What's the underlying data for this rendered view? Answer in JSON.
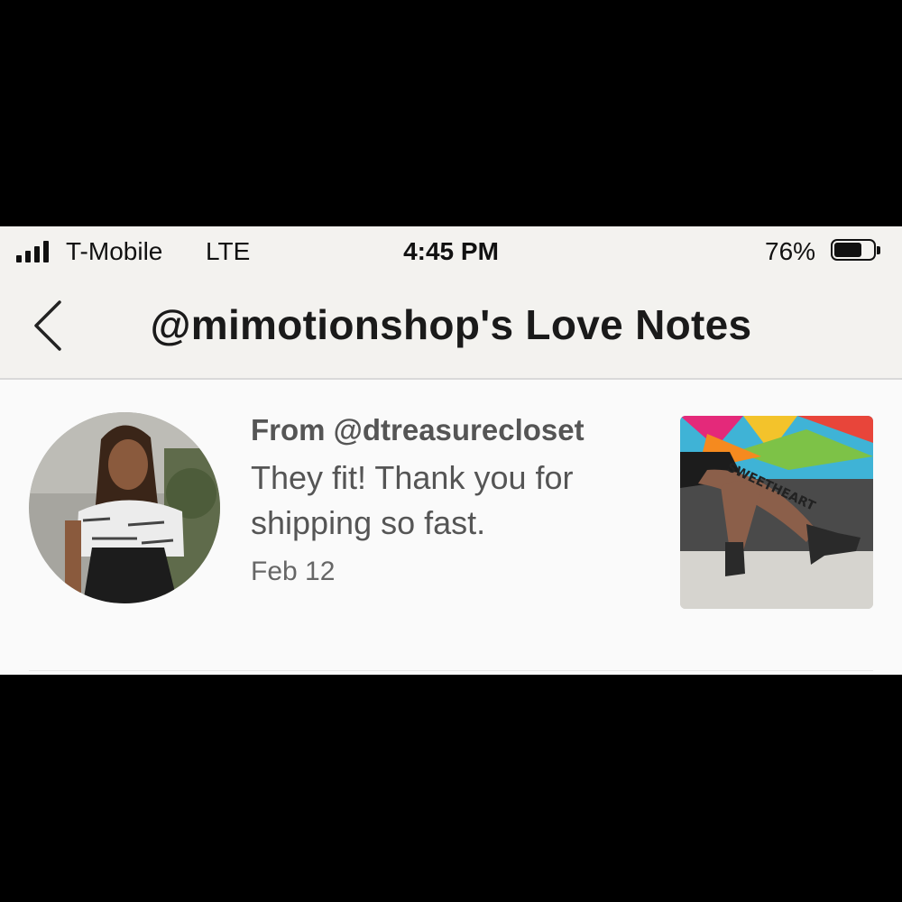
{
  "status_bar": {
    "carrier": "T-Mobile",
    "network": "LTE",
    "time": "4:45 PM",
    "battery_percent": "76%",
    "battery_level": 0.76
  },
  "nav": {
    "title": "@mimotionshop's Love Notes",
    "back_icon": "chevron-left-icon"
  },
  "notes": [
    {
      "from": "From @dtreasurecloset",
      "message": "They fit! Thank you for shipping so fast.",
      "date": "Feb 12",
      "thumb_caption": "SWEETHEART"
    }
  ],
  "colors": {
    "background": "#fafafa",
    "header_bg": "#f3f2ef",
    "text_primary": "#1a1a1a",
    "text_secondary": "#555555",
    "divider": "#d9d9d9"
  }
}
